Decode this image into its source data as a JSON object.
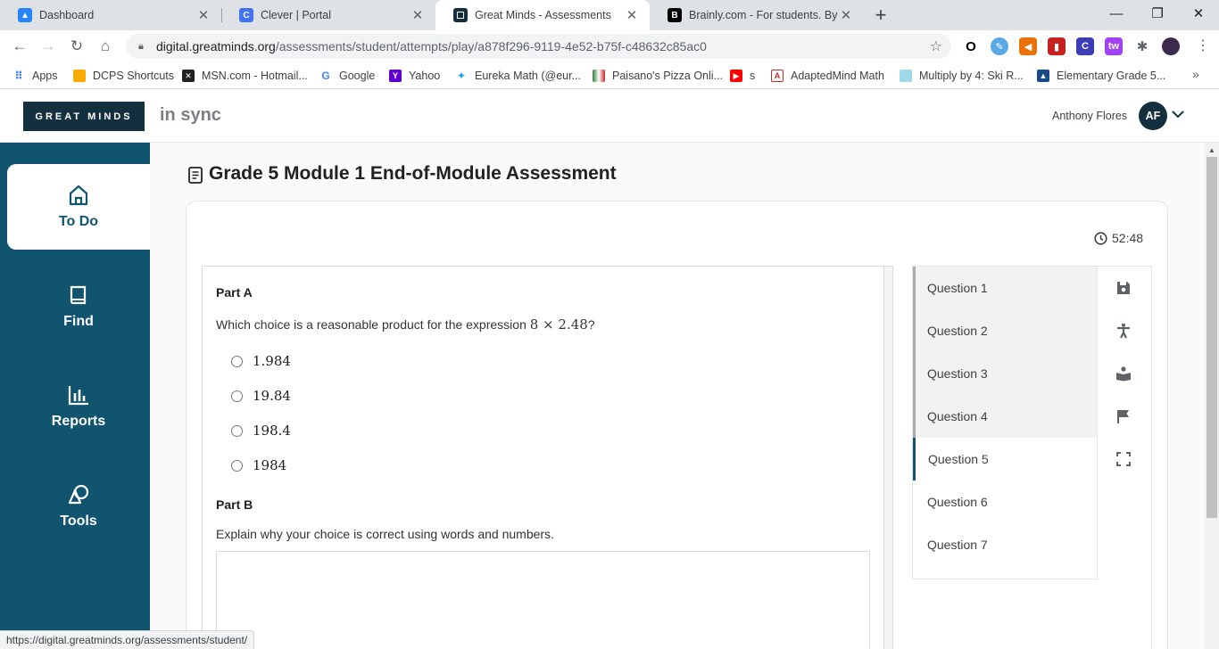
{
  "browser": {
    "tabs": [
      {
        "title": "Dashboard",
        "favicon": "atlassian-icon",
        "color": "#2684ff"
      },
      {
        "title": "Clever | Portal",
        "favicon": "clever-icon",
        "color": "#4274f6"
      },
      {
        "title": "Great Minds - Assessments",
        "favicon": "greatminds-icon",
        "color": "#14303e"
      },
      {
        "title": "Brainly.com - For students. By stu",
        "favicon": "brainly-icon",
        "color": "#000000"
      }
    ],
    "url_host": "digital.greatminds.org",
    "url_path": "/assessments/student/attempts/play/a878f296-9119-4e52-b75f-c48632c85ac0",
    "bookmarks": [
      "Apps",
      "DCPS Shortcuts",
      "MSN.com - Hotmail...",
      "Google",
      "Yahoo",
      "Eureka Math (@eur...",
      "Paisano's Pizza Onli...",
      "s",
      "AdaptedMind Math",
      "Multiply by 4: Ski R...",
      "Elementary Grade 5..."
    ],
    "status_url": "https://digital.greatminds.org/assessments/student/"
  },
  "header": {
    "logo": "GREAT MINDS",
    "product": "in sync",
    "user_name": "Anthony Flores",
    "avatar_initials": "AF"
  },
  "nav": [
    {
      "label": "To Do",
      "icon": "home-icon",
      "active": true
    },
    {
      "label": "Find",
      "icon": "book-icon",
      "active": false
    },
    {
      "label": "Reports",
      "icon": "bar-chart-icon",
      "active": false
    },
    {
      "label": "Tools",
      "icon": "shapes-icon",
      "active": false
    }
  ],
  "assessment": {
    "title": "Grade 5 Module 1 End-of-Module Assessment",
    "timer": "52:48",
    "part_a_label": "Part A",
    "question_prefix": "Which choice is a reasonable product for the expression",
    "question_math": "8 × 2.48",
    "question_suffix": "?",
    "choices": [
      "1.984",
      "19.84",
      "198.4",
      "1984"
    ],
    "part_b_label": "Part B",
    "part_b_prompt": "Explain why your choice is correct using words and numbers."
  },
  "questions": [
    {
      "label": "Question 1",
      "state": "done"
    },
    {
      "label": "Question 2",
      "state": "done"
    },
    {
      "label": "Question 3",
      "state": "done"
    },
    {
      "label": "Question 4",
      "state": "done"
    },
    {
      "label": "Question 5",
      "state": "current"
    },
    {
      "label": "Question 6",
      "state": "todo"
    },
    {
      "label": "Question 7",
      "state": "todo"
    }
  ],
  "tools": [
    "save-icon",
    "accessibility-icon",
    "reader-icon",
    "flag-icon",
    "fullscreen-icon"
  ],
  "colors": {
    "brand_dark": "#14303e",
    "nav_bg": "#105470",
    "page_bg": "#fafafa"
  }
}
